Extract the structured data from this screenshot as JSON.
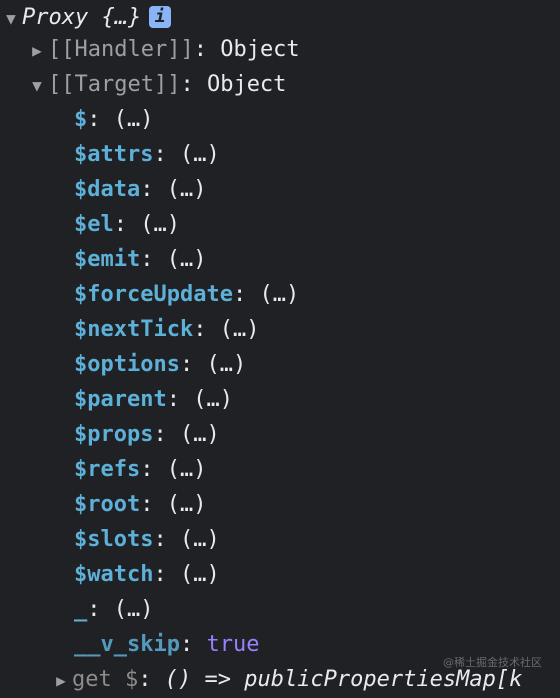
{
  "proxy": {
    "title": "Proxy {…}",
    "info_icon": "i",
    "handler": {
      "key": "[[Handler]]",
      "value": "Object"
    },
    "target": {
      "key": "[[Target]]",
      "value": "Object"
    }
  },
  "properties": [
    {
      "key": "$",
      "value": "(…)"
    },
    {
      "key": "$attrs",
      "value": "(…)"
    },
    {
      "key": "$data",
      "value": "(…)"
    },
    {
      "key": "$el",
      "value": "(…)"
    },
    {
      "key": "$emit",
      "value": "(…)"
    },
    {
      "key": "$forceUpdate",
      "value": "(…)"
    },
    {
      "key": "$nextTick",
      "value": "(…)"
    },
    {
      "key": "$options",
      "value": "(…)"
    },
    {
      "key": "$parent",
      "value": "(…)"
    },
    {
      "key": "$props",
      "value": "(…)"
    },
    {
      "key": "$refs",
      "value": "(…)"
    },
    {
      "key": "$root",
      "value": "(…)"
    },
    {
      "key": "$slots",
      "value": "(…)"
    },
    {
      "key": "$watch",
      "value": "(…)"
    },
    {
      "key": "_",
      "value": "(…)"
    },
    {
      "key": "__v_skip",
      "value": "true"
    }
  ],
  "getter": {
    "key": "get $",
    "value": "() => publicPropertiesMap[k"
  },
  "watermark": "@稀土掘金技术社区"
}
